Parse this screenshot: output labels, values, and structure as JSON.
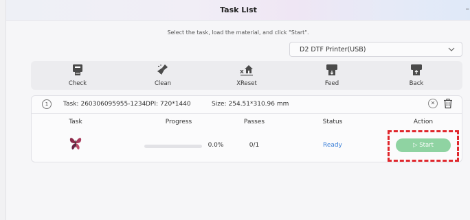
{
  "window": {
    "title": "Task List",
    "minimize_glyph": "–"
  },
  "instruction": "Select the task, load the material, and click \"Start\".",
  "printer": {
    "selected": "D2 DTF Printer(USB)"
  },
  "toolbar": {
    "items": [
      {
        "label": "Check",
        "icon": "check-printer-icon"
      },
      {
        "label": "Clean",
        "icon": "clean-brush-icon"
      },
      {
        "label": "XReset",
        "icon": "x-reset-home-icon"
      },
      {
        "label": "Feed",
        "icon": "feed-printer-icon"
      },
      {
        "label": "Back",
        "icon": "back-printer-icon"
      }
    ]
  },
  "task": {
    "index": "1",
    "task_label": "Task:",
    "task_id": "260306095955-1234",
    "dpi_label": "DPI:",
    "dpi": "720*1440",
    "size_label": "Size:",
    "size": "254.51*310.96 mm",
    "columns": [
      "Task",
      "Progress",
      "Passes",
      "Status",
      "Action"
    ],
    "row": {
      "progress_text": "0.0%",
      "progress_value": 0.0,
      "passes": "0/1",
      "status": "Ready",
      "action_label": "▷ Start"
    }
  },
  "colors": {
    "status_ready": "#3a7fd8",
    "start_button": "#8fd3a2",
    "highlight": "#e0262c"
  }
}
